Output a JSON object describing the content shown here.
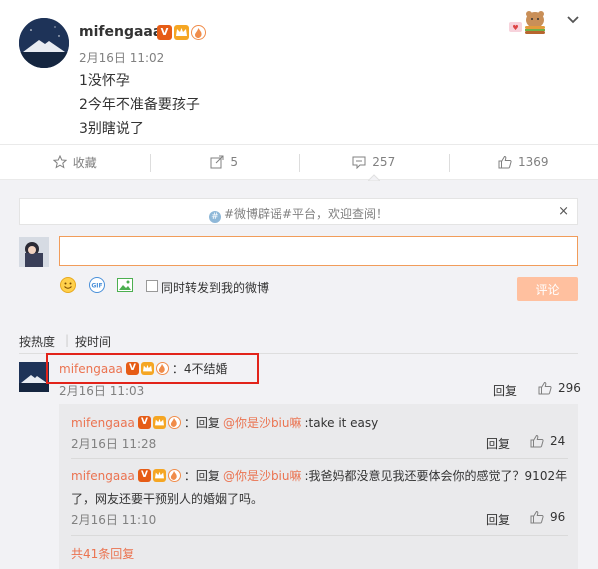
{
  "post": {
    "username": "mifengaaa",
    "time": "2月16日 11:02",
    "lines": [
      "1没怀孕",
      "2今年不准备要孩子",
      "3别瞎说了"
    ]
  },
  "actions": {
    "favorite": "收藏",
    "forward": "5",
    "comment": "257",
    "like": "1369"
  },
  "notice": {
    "text": "#微博辟谣#平台，欢迎查阅！",
    "close": "×"
  },
  "composer": {
    "input_value": "",
    "forward_label": "同时转发到我的微博",
    "submit": "评论"
  },
  "sort": {
    "hot": "按热度",
    "time": "按时间"
  },
  "comment": {
    "username": "mifengaaa",
    "text": "：4不结婚",
    "time": "2月16日 11:03",
    "reply": "回复",
    "likes": "296"
  },
  "replies": [
    {
      "username": "mifengaaa",
      "prefix": "：回复",
      "mention": "@你是沙biu嘛",
      "text": ":take it easy",
      "time": "2月16日 11:28",
      "reply": "回复",
      "likes": "24"
    },
    {
      "username": "mifengaaa",
      "prefix": "：回复",
      "mention": "@你是沙biu嘛",
      "text": ":我爸妈都没意见我还要体会你的感觉了？9102年",
      "text2": "了，网友还要干预别人的婚姻了吗。",
      "time": "2月16日 11:10",
      "reply": "回复",
      "likes": "96"
    }
  ],
  "more_replies": "共41条回复",
  "colors": {
    "accent": "#eb7350",
    "highlight_border": "#e2231a",
    "submit_disabled": "#ffc09f"
  }
}
